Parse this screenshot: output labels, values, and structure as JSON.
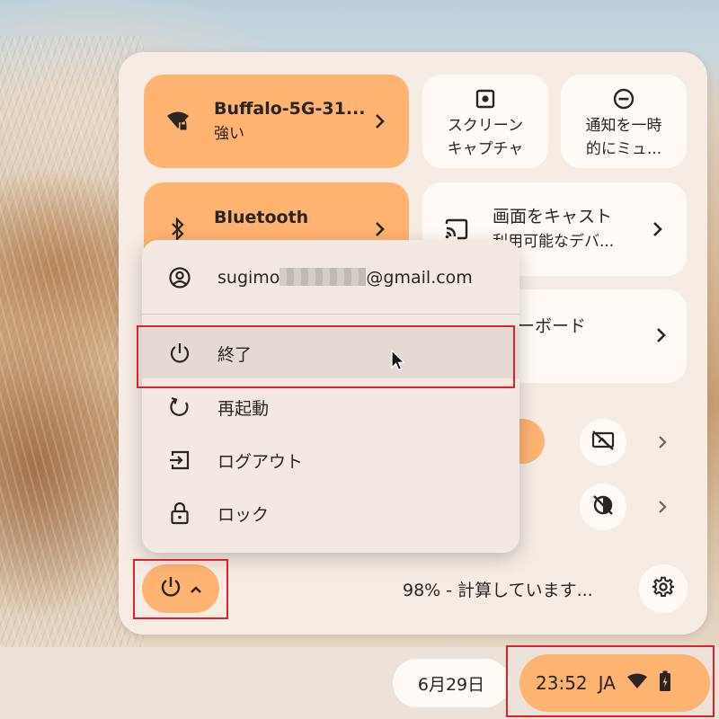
{
  "quick_settings": {
    "network": {
      "title": "Buffalo-5G-31...",
      "status": "強い"
    },
    "screen_capture": {
      "label": "スクリーン\nキャプチャ"
    },
    "notifications": {
      "label": "通知を一時\n的にミュ..."
    },
    "bluetooth": {
      "title": "Bluetooth"
    },
    "cast": {
      "title": "画面をキャスト",
      "status": "利用可能なデバ..."
    },
    "keyboard": {
      "title": "ーボード"
    },
    "battery_text": "98% - 計算しています..."
  },
  "power_menu": {
    "account_prefix": "sugimo",
    "account_suffix": "@gmail.com",
    "items": [
      {
        "label": "終了",
        "icon": "power-icon"
      },
      {
        "label": "再起動",
        "icon": "restart-icon"
      },
      {
        "label": "ログアウト",
        "icon": "sign-out-icon"
      },
      {
        "label": "ロック",
        "icon": "lock-icon"
      }
    ]
  },
  "shelf": {
    "date": "6月29日",
    "time": "23:52",
    "ime": "JA"
  },
  "colors": {
    "accent": "#ffb371",
    "panel": "#f6ece4",
    "annotation": "#e0212b"
  }
}
